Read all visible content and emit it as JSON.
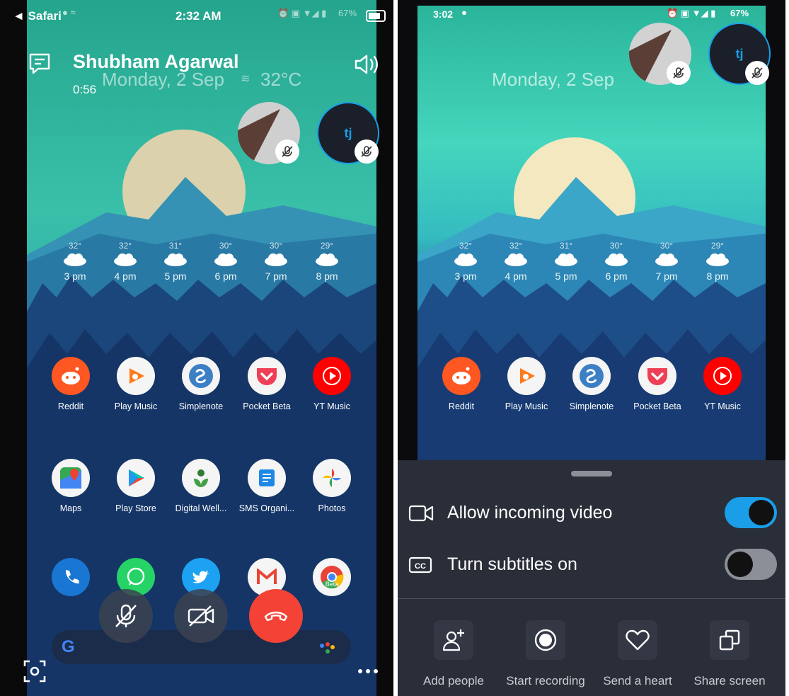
{
  "left": {
    "status": {
      "back": "◄ Safari",
      "time": "2:32 AM",
      "battery": "67%"
    },
    "call": {
      "name": "Shubham Agarwal",
      "duration": "0:56"
    },
    "wallpaper": {
      "date": "Monday, 2 Sep",
      "temp": "32°C"
    },
    "participant_initials": "tj"
  },
  "right": {
    "status": {
      "time": "3:02",
      "battery": "67%"
    },
    "wallpaper": {
      "date": "Monday, 2 Sep"
    },
    "participant_initials": "tj",
    "sheet": {
      "allow_video": {
        "label": "Allow incoming video",
        "on": true
      },
      "subtitles": {
        "label": "Turn subtitles on",
        "on": false
      },
      "actions": [
        {
          "label": "Add people",
          "icon": "add-person-icon"
        },
        {
          "label": "Start recording",
          "icon": "record-icon"
        },
        {
          "label": "Send a heart",
          "icon": "heart-icon"
        },
        {
          "label": "Share screen",
          "icon": "share-screen-icon"
        }
      ]
    }
  },
  "forecast": [
    {
      "temp": "32°",
      "hour": "3 pm"
    },
    {
      "temp": "32°",
      "hour": "4 pm"
    },
    {
      "temp": "31°",
      "hour": "5 pm"
    },
    {
      "temp": "30°",
      "hour": "6 pm"
    },
    {
      "temp": "30°",
      "hour": "7 pm"
    },
    {
      "temp": "29°",
      "hour": "8 pm"
    }
  ],
  "apps_row1": [
    "Reddit",
    "Play Music",
    "Simplenote",
    "Pocket Beta",
    "YT Music"
  ],
  "apps_row2": [
    "Maps",
    "Play Store",
    "Digital Well...",
    "SMS Organi...",
    "Photos"
  ],
  "dock_beta_label": "Beta",
  "search_logo": "G",
  "colors": {
    "accent": "#1a9ee8",
    "end_call": "#f44336",
    "sheet_bg": "#2a2e38"
  }
}
